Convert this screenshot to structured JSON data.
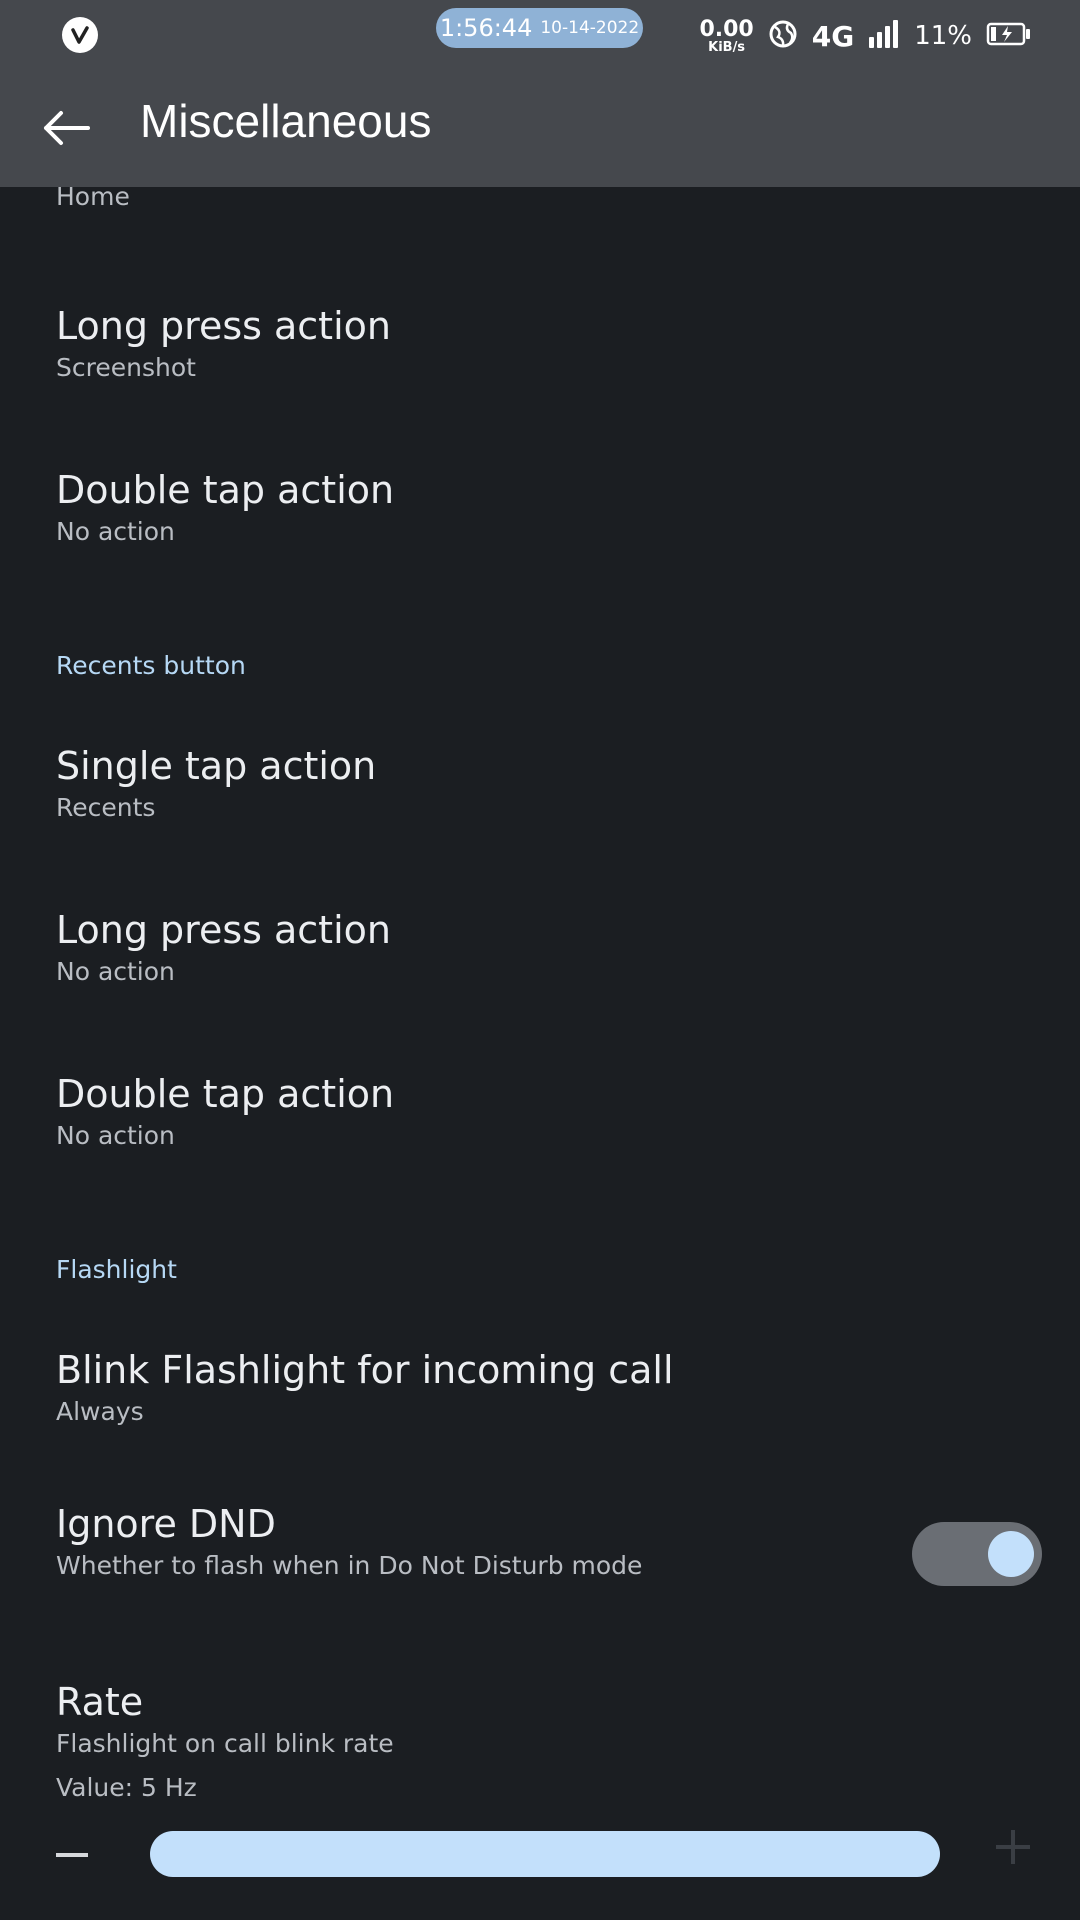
{
  "status_bar": {
    "time": "1:56:44",
    "date": "10-14-2022",
    "net_speed_value": "0.00",
    "net_speed_unit": "KiB/s",
    "network": "4G",
    "battery": "11%",
    "icons": [
      "app-logo-icon",
      "globe-icon",
      "signal-icon",
      "battery-charging-icon"
    ]
  },
  "app_bar": {
    "title": "Miscellaneous",
    "back_icon": "back-arrow-icon"
  },
  "settings": {
    "partial_item": {
      "summary": "Home"
    },
    "home_long_press": {
      "title": "Long press action",
      "summary": "Screenshot"
    },
    "home_double_tap": {
      "title": "Double tap action",
      "summary": "No action"
    },
    "recents_category": "Recents button",
    "recents_single_tap": {
      "title": "Single tap action",
      "summary": "Recents"
    },
    "recents_long_press": {
      "title": "Long press action",
      "summary": "No action"
    },
    "recents_double_tap": {
      "title": "Double tap action",
      "summary": "No action"
    },
    "flashlight_category": "Flashlight",
    "blink_flashlight": {
      "title": "Blink Flashlight for incoming call",
      "summary": "Always"
    },
    "ignore_dnd": {
      "title": "Ignore DND",
      "summary": "Whether to flash when in Do Not Disturb mode",
      "enabled": true
    },
    "rate": {
      "title": "Rate",
      "summary": "Flashlight on call blink rate",
      "value_label": "Value: 5 Hz",
      "slider_fraction": 1.0
    }
  },
  "colors": {
    "background": "#1b1e22",
    "toolbar": "#45484d",
    "accent": "#c3e0fb",
    "category_text": "#b6d8f5"
  }
}
